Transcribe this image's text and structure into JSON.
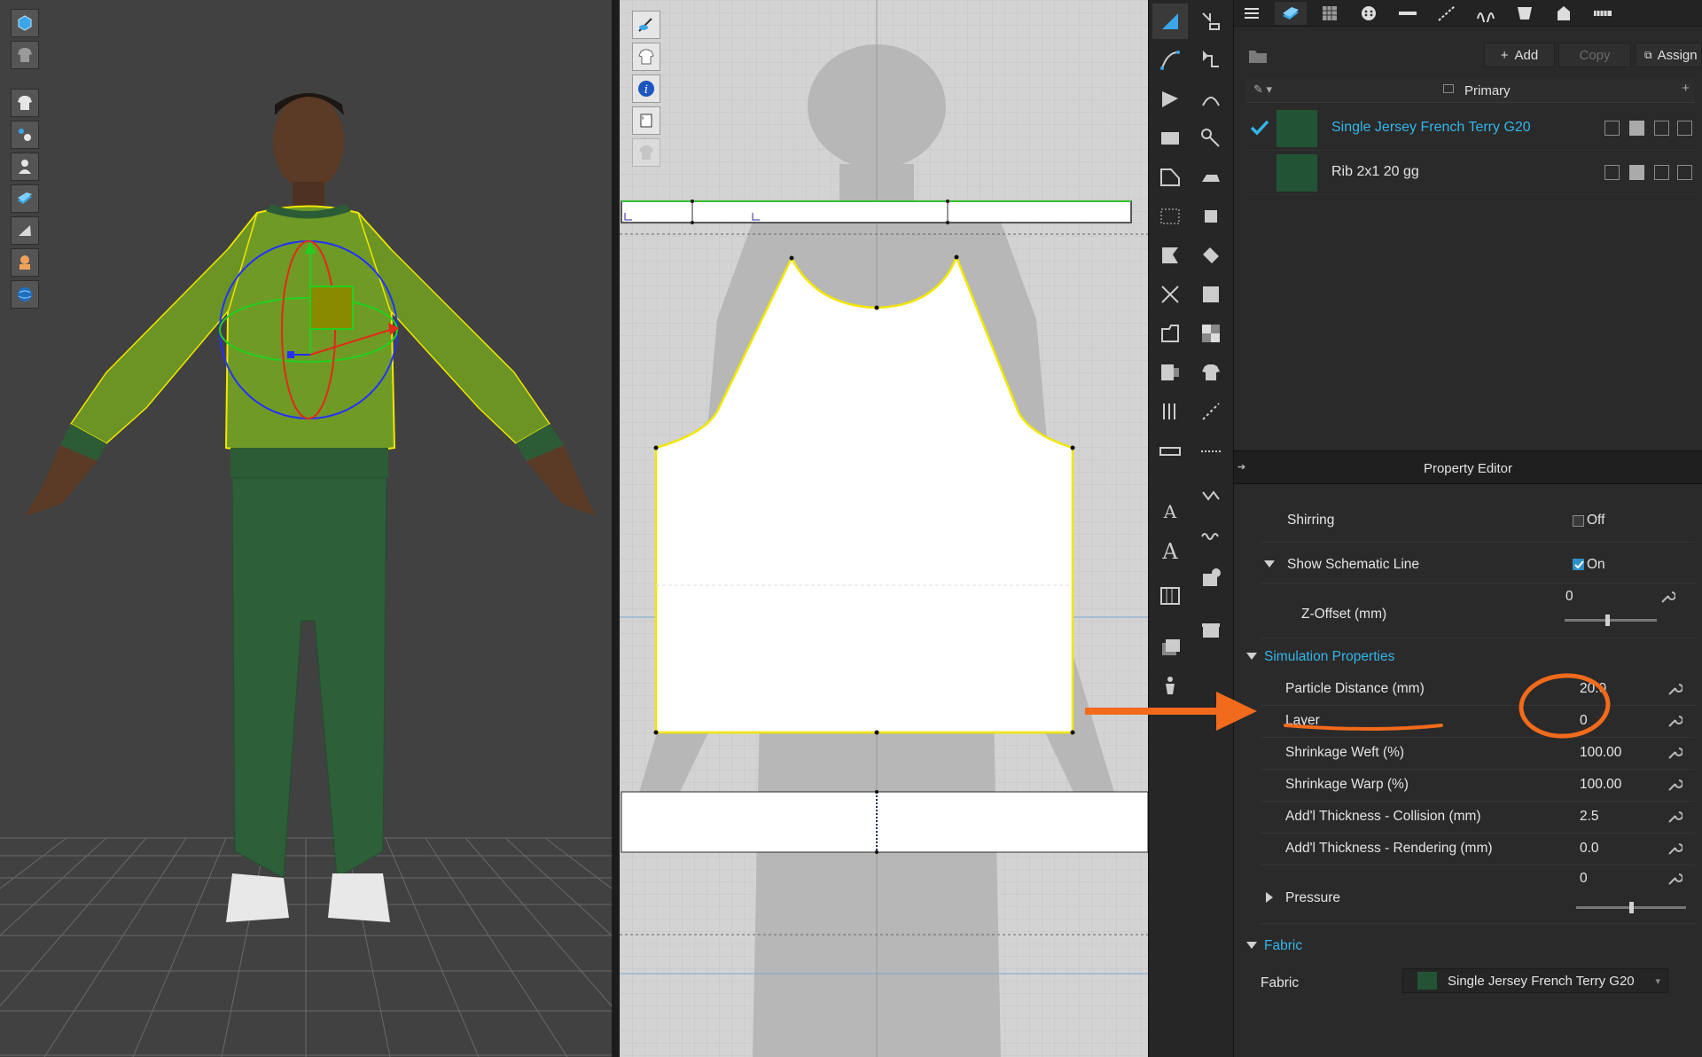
{
  "object_browser": {
    "add_label": "Add",
    "copy_label": "Copy",
    "assign_label": "Assign",
    "group_label": "Primary",
    "fabrics": [
      {
        "name": "Single Jersey French Terry G20",
        "selected": true,
        "color": "#235335"
      },
      {
        "name": "Rib 2x1 20 gg",
        "selected": false,
        "color": "#235335"
      }
    ]
  },
  "property_editor": {
    "title": "Property Editor",
    "shirring": {
      "label": "Shirring",
      "value": "Off",
      "checked": false
    },
    "schematic": {
      "label": "Show Schematic Line",
      "value": "On",
      "checked": true
    },
    "zoffset": {
      "label": "Z-Offset (mm)",
      "value": "0",
      "slider": 0.46
    },
    "simulation": {
      "title": "Simulation Properties",
      "particle_distance": {
        "label": "Particle Distance (mm)",
        "value": "20.0"
      },
      "layer": {
        "label": "Layer",
        "value": "0"
      },
      "shrink_weft": {
        "label": "Shrinkage Weft (%)",
        "value": "100.00"
      },
      "shrink_warp": {
        "label": "Shrinkage Warp (%)",
        "value": "100.00"
      },
      "thick_collision": {
        "label": "Add'l Thickness - Collision (mm)",
        "value": "2.5"
      },
      "thick_render": {
        "label": "Add'l Thickness - Rendering (mm)",
        "value": "0.0"
      },
      "pressure": {
        "label": "Pressure",
        "value": "0",
        "slider": 0.5
      }
    },
    "fabric_section": {
      "title": "Fabric",
      "fabric": {
        "label": "Fabric",
        "value": "Single Jersey French Terry G20"
      }
    }
  },
  "colors": {
    "accent_blue": "#33b6ea",
    "annotation_orange": "#f26a1b",
    "garment_green": "#6f9a26",
    "pants_green": "#2d5f38",
    "pattern_outline": "#f2e600"
  }
}
